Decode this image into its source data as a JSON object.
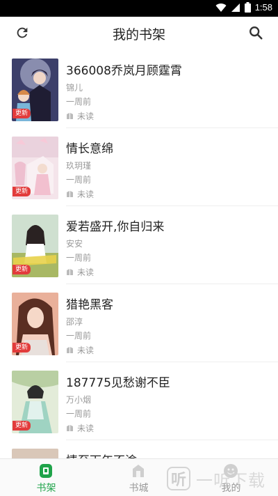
{
  "status_bar": {
    "time": "1:58",
    "icons": [
      "wifi-icon",
      "signal-icon",
      "battery-icon"
    ]
  },
  "header": {
    "title": "我的书架",
    "left_icon": "refresh-icon",
    "right_icon": "search-icon"
  },
  "books": [
    {
      "title": "366008乔岚月顾霆霄",
      "author": "锦儿",
      "time": "一周前",
      "status": "未读",
      "tag": "更新"
    },
    {
      "title": "情长意绵",
      "author": "玖玥瑾",
      "time": "一周前",
      "status": "未读",
      "tag": "更新"
    },
    {
      "title": "爱若盛开,你自归来",
      "author": "安安",
      "time": "一周前",
      "status": "未读",
      "tag": "更新"
    },
    {
      "title": "猎艳黑客",
      "author": "邵淳",
      "time": "一周前",
      "status": "未读",
      "tag": "更新"
    },
    {
      "title": "187775见愁谢不臣",
      "author": "万小烟",
      "time": "一周前",
      "status": "未读",
      "tag": "更新"
    },
    {
      "title": "情至下年不渝",
      "author": "",
      "time": "",
      "status": "",
      "tag": ""
    }
  ],
  "nav": [
    {
      "label": "书架",
      "icon": "bookshelf-icon",
      "active": true
    },
    {
      "label": "书城",
      "icon": "bookstore-icon",
      "active": false
    },
    {
      "label": "我的",
      "icon": "profile-icon",
      "active": false
    }
  ],
  "watermark": {
    "text": "一听下载",
    "icon_glyph": "听"
  },
  "colors": {
    "accent": "#1fa34a",
    "update_tag": "#e23b3b",
    "secondary_text": "#9a9a9a"
  }
}
